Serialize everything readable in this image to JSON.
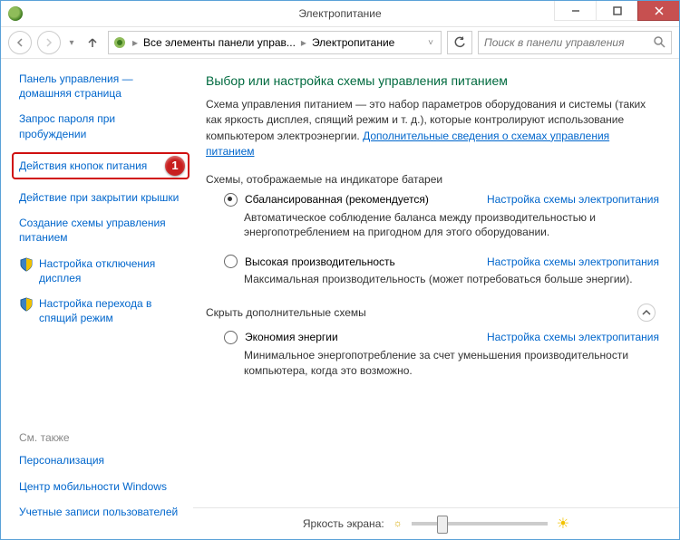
{
  "titlebar": {
    "title": "Электропитание"
  },
  "win_controls": {
    "min": "—",
    "max": "□",
    "close": "✕"
  },
  "navbar": {
    "crumb1": "Все элементы панели управ...",
    "crumb2": "Электропитание",
    "search_placeholder": "Поиск в панели управления"
  },
  "sidebar": {
    "home": "Панель управления — домашняя страница",
    "links": [
      "Запрос пароля при пробуждении",
      "Действия кнопок питания",
      "Действие при закрытии крышки",
      "Создание схемы управления питанием",
      "Настройка отключения дисплея",
      "Настройка перехода в спящий режим"
    ],
    "callout": "1",
    "see_also_heading": "См. также",
    "see_also": [
      "Персонализация",
      "Центр мобильности Windows",
      "Учетные записи пользователей"
    ]
  },
  "main": {
    "heading": "Выбор или настройка схемы управления питанием",
    "intro_text": "Схема управления питанием — это набор параметров оборудования и системы (таких как яркость дисплея, спящий режим и т. д.), которые контролируют использование компьютером электроэнергии. ",
    "intro_link": "Дополнительные сведения о схемах управления питанием",
    "section1_title": "Схемы, отображаемые на индикаторе батареи",
    "plans": [
      {
        "name": "Сбалансированная (рекомендуется)",
        "link": "Настройка схемы электропитания",
        "desc": "Автоматическое соблюдение баланса между производительностью и энергопотреблением на пригодном для этого оборудовании.",
        "selected": true
      },
      {
        "name": "Высокая производительность",
        "link": "Настройка схемы электропитания",
        "desc": "Максимальная производительность (может потребоваться больше энергии).",
        "selected": false
      }
    ],
    "collapse_label": "Скрыть дополнительные схемы",
    "extra_plans": [
      {
        "name": "Экономия энергии",
        "link": "Настройка схемы электропитания",
        "desc": "Минимальное энергопотребление за счет уменьшения производительности компьютера, когда это возможно.",
        "selected": false
      }
    ]
  },
  "footer": {
    "brightness_label": "Яркость экрана:"
  }
}
